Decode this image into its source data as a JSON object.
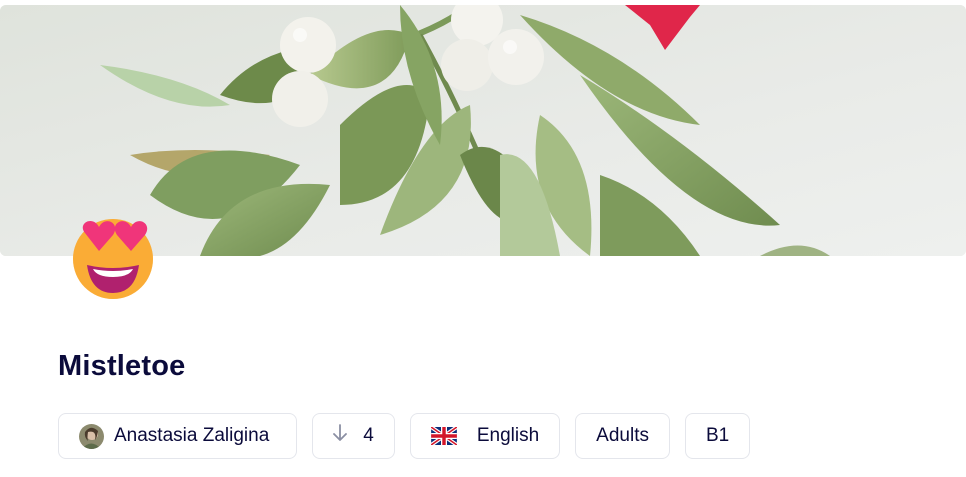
{
  "lesson": {
    "title": "Mistletoe",
    "cover_image": "mistletoe-paper-craft",
    "emoji_icon": "heart-eyes-face-icon"
  },
  "chips": {
    "author": {
      "name": "Anastasia Zaligina",
      "icon": "avatar"
    },
    "downloads": {
      "count": "4",
      "icon": "arrow-down-icon"
    },
    "language": {
      "label": "English",
      "icon": "uk-flag-icon"
    },
    "audience": {
      "label": "Adults"
    },
    "level": {
      "label": "B1"
    }
  },
  "colors": {
    "title": "#0b0b3b",
    "chip_border": "#e4e6ec",
    "leaf": "#8aa468",
    "berry": "#f1f0ea",
    "ribbon": "#e0264a"
  }
}
